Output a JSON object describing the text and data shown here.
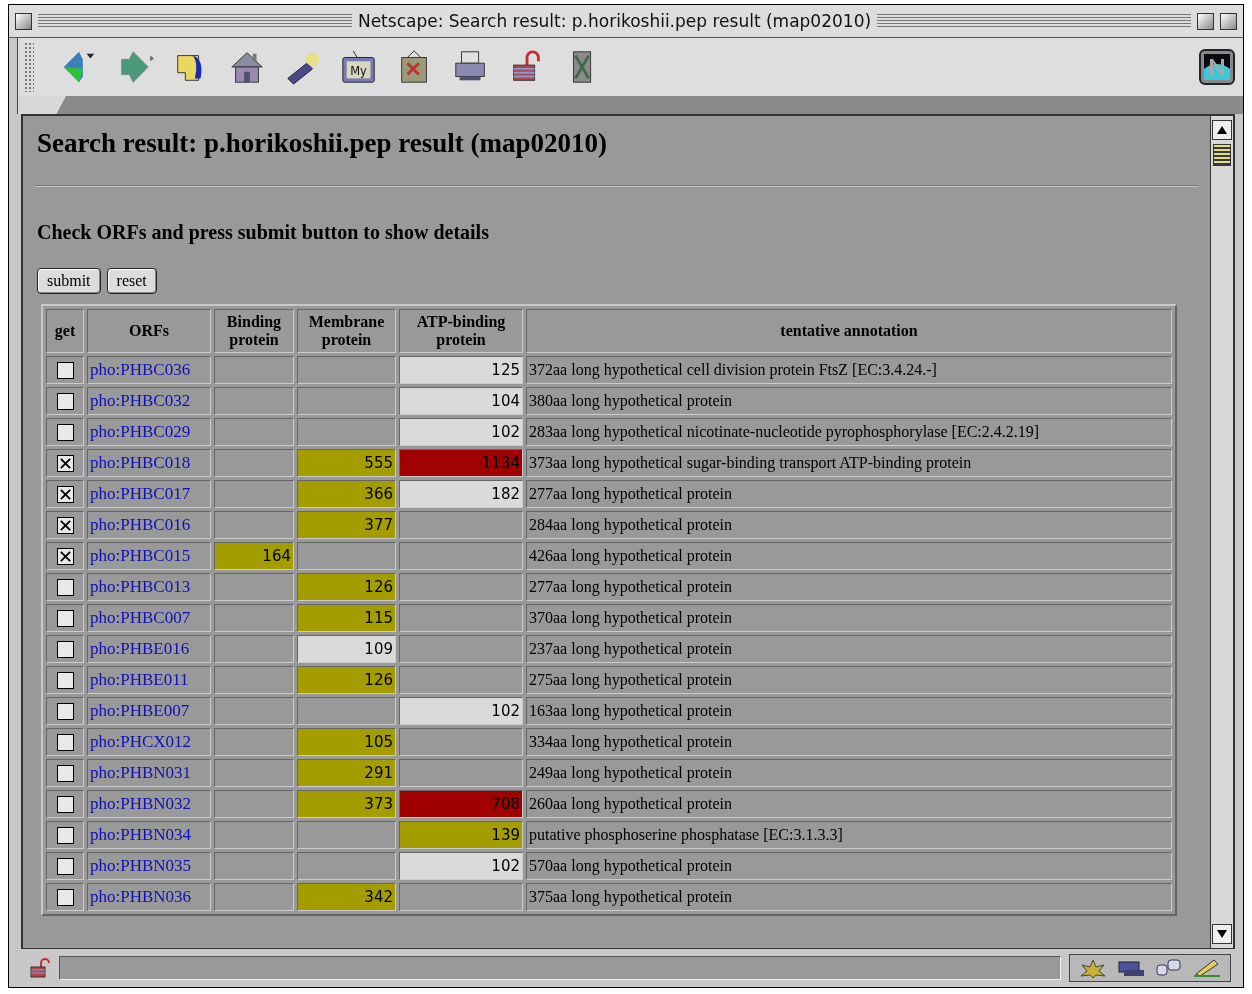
{
  "window": {
    "title": "Netscape: Search result: p.horikoshii.pep result (map02010)"
  },
  "toolbar": {
    "my_label": "My"
  },
  "page": {
    "heading": "Search result: p.horikoshii.pep result (map02010)",
    "instruction": "Check ORFs and press submit button to show details",
    "buttons": [
      "submit",
      "reset"
    ],
    "columns": [
      "get",
      "ORFs",
      "Binding protein",
      "Membrane protein",
      "ATP-binding protein",
      "tentative annotation"
    ],
    "rows": [
      {
        "checked": false,
        "orf": "pho:PHBC036",
        "binding": null,
        "membrane": null,
        "atp": {
          "value": "125",
          "color": "#dadada"
        },
        "annotation": "372aa long hypothetical cell division protein FtsZ [EC:3.4.24.-]"
      },
      {
        "checked": false,
        "orf": "pho:PHBC032",
        "binding": null,
        "membrane": null,
        "atp": {
          "value": "104",
          "color": "#dadada"
        },
        "annotation": "380aa long hypothetical protein"
      },
      {
        "checked": false,
        "orf": "pho:PHBC029",
        "binding": null,
        "membrane": null,
        "atp": {
          "value": "102",
          "color": "#dadada"
        },
        "annotation": "283aa long hypothetical nicotinate-nucleotide pyrophosphorylase [EC:2.4.2.19]"
      },
      {
        "checked": true,
        "orf": "pho:PHBC018",
        "binding": null,
        "membrane": {
          "value": "555",
          "color": "#a39d00"
        },
        "atp": {
          "value": "1134",
          "color": "#a00000"
        },
        "annotation": "373aa long hypothetical sugar-binding transport ATP-binding protein"
      },
      {
        "checked": true,
        "orf": "pho:PHBC017",
        "binding": null,
        "membrane": {
          "value": "366",
          "color": "#a39d00"
        },
        "atp": {
          "value": "182",
          "color": "#dadada"
        },
        "annotation": "277aa long hypothetical protein"
      },
      {
        "checked": true,
        "orf": "pho:PHBC016",
        "binding": null,
        "membrane": {
          "value": "377",
          "color": "#a39d00"
        },
        "atp": null,
        "annotation": "284aa long hypothetical protein"
      },
      {
        "checked": true,
        "orf": "pho:PHBC015",
        "binding": {
          "value": "164",
          "color": "#a39d00"
        },
        "membrane": null,
        "atp": null,
        "annotation": "426aa long hypothetical protein"
      },
      {
        "checked": false,
        "orf": "pho:PHBC013",
        "binding": null,
        "membrane": {
          "value": "126",
          "color": "#a39d00"
        },
        "atp": null,
        "annotation": "277aa long hypothetical protein"
      },
      {
        "checked": false,
        "orf": "pho:PHBC007",
        "binding": null,
        "membrane": {
          "value": "115",
          "color": "#a39d00"
        },
        "atp": null,
        "annotation": "370aa long hypothetical protein"
      },
      {
        "checked": false,
        "orf": "pho:PHBE016",
        "binding": null,
        "membrane": {
          "value": "109",
          "color": "#dadada"
        },
        "atp": null,
        "annotation": "237aa long hypothetical protein"
      },
      {
        "checked": false,
        "orf": "pho:PHBE011",
        "binding": null,
        "membrane": {
          "value": "126",
          "color": "#a39d00"
        },
        "atp": null,
        "annotation": "275aa long hypothetical protein"
      },
      {
        "checked": false,
        "orf": "pho:PHBE007",
        "binding": null,
        "membrane": null,
        "atp": {
          "value": "102",
          "color": "#dadada"
        },
        "annotation": "163aa long hypothetical protein"
      },
      {
        "checked": false,
        "orf": "pho:PHCX012",
        "binding": null,
        "membrane": {
          "value": "105",
          "color": "#a39d00"
        },
        "atp": null,
        "annotation": "334aa long hypothetical protein"
      },
      {
        "checked": false,
        "orf": "pho:PHBN031",
        "binding": null,
        "membrane": {
          "value": "291",
          "color": "#a39d00"
        },
        "atp": null,
        "annotation": "249aa long hypothetical protein"
      },
      {
        "checked": false,
        "orf": "pho:PHBN032",
        "binding": null,
        "membrane": {
          "value": "373",
          "color": "#a39d00"
        },
        "atp": {
          "value": "708",
          "color": "#a00000"
        },
        "annotation": "260aa long hypothetical protein"
      },
      {
        "checked": false,
        "orf": "pho:PHBN034",
        "binding": null,
        "membrane": null,
        "atp": {
          "value": "139",
          "color": "#a39d00"
        },
        "annotation": "putative phosphoserine phosphatase [EC:3.1.3.3]"
      },
      {
        "checked": false,
        "orf": "pho:PHBN035",
        "binding": null,
        "membrane": null,
        "atp": {
          "value": "102",
          "color": "#dadada"
        },
        "annotation": "570aa long hypothetical protein"
      },
      {
        "checked": false,
        "orf": "pho:PHBN036",
        "binding": null,
        "membrane": {
          "value": "342",
          "color": "#a39d00"
        },
        "atp": null,
        "annotation": "375aa long hypothetical protein"
      }
    ]
  }
}
